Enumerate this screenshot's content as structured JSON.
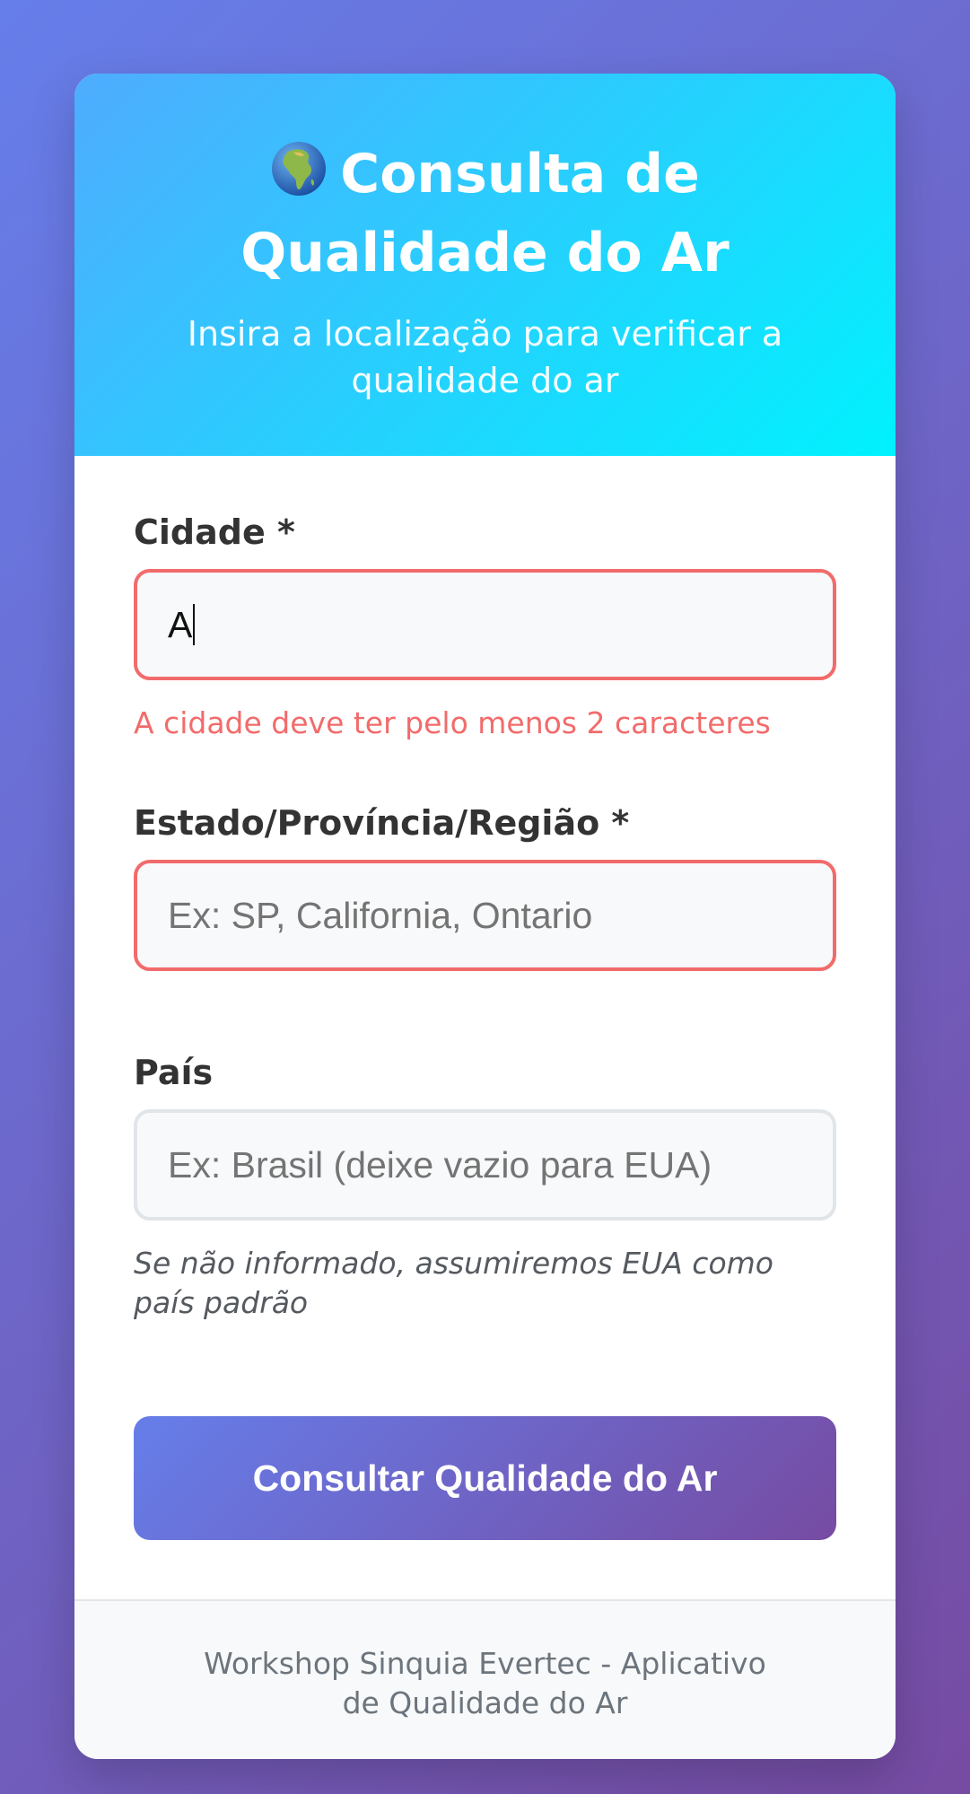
{
  "header": {
    "globe_icon": "globe-africa-icon",
    "title": "Consulta de Qualidade do Ar",
    "subtitle": "Insira a localização para verificar a qualidade do ar"
  },
  "form": {
    "city": {
      "label": "Cidade *",
      "value": "A",
      "error": "A cidade deve ter pelo menos 2 caracteres"
    },
    "state": {
      "label": "Estado/Província/Região *",
      "placeholder": "Ex: SP, California, Ontario"
    },
    "country": {
      "label": "País",
      "placeholder": "Ex: Brasil (deixe vazio para EUA)",
      "hint": "Se não informado, assumiremos EUA como país padrão"
    },
    "submit_label": "Consultar Qualidade do Ar"
  },
  "footer": {
    "text": "Workshop Sinquia Evertec - Aplicativo de Qualidade do Ar"
  },
  "colors": {
    "page_gradient": [
      "#667eea",
      "#764ba2"
    ],
    "header_gradient": [
      "#4facfe",
      "#00f2fe"
    ],
    "error": "#f26b6b"
  }
}
